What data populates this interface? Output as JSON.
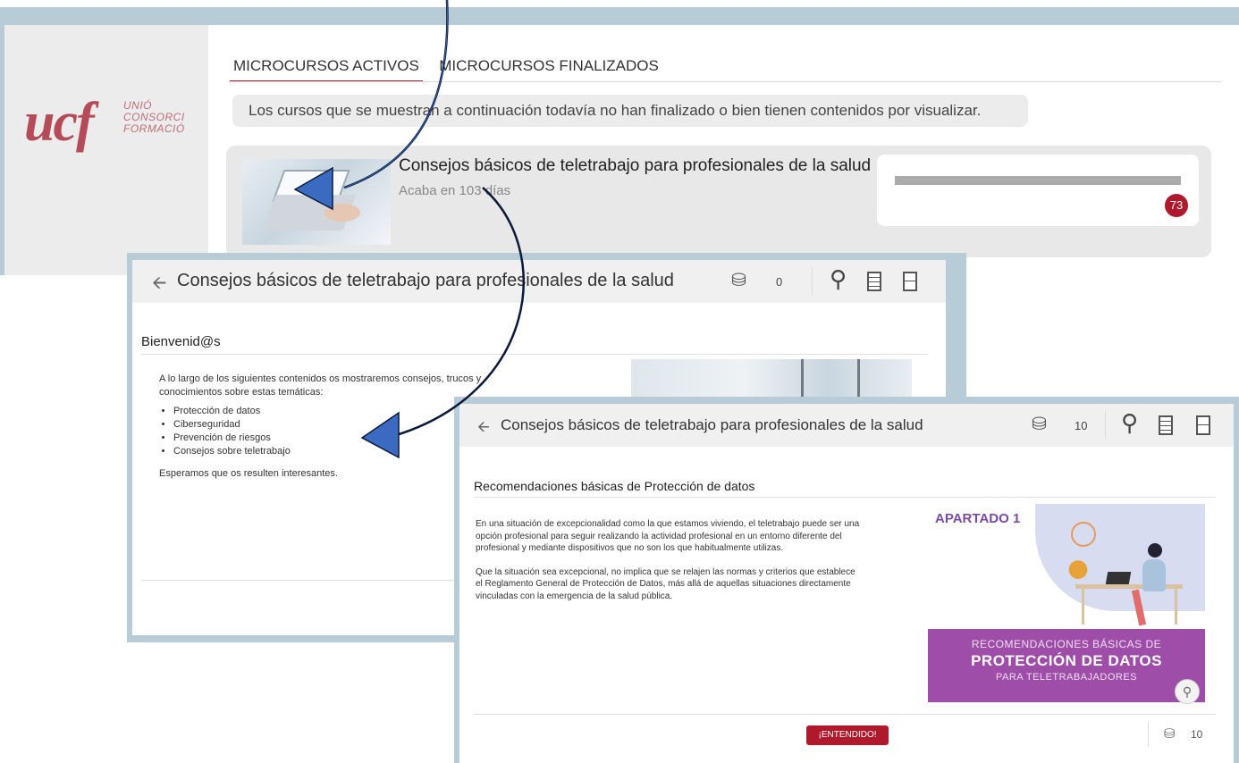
{
  "logo": {
    "mark": "ucf",
    "line1": "UNIÓ",
    "line2": "CONSORCI",
    "line3": "FORMACIÓ"
  },
  "tabs": [
    {
      "label": "MICROCURSOS ACTIVOS",
      "active": true
    },
    {
      "label": "MICROCURSOS FINALIZADOS",
      "active": false
    }
  ],
  "info_banner": "Los cursos que se muestran a continuación todavía no han finalizado o bien tienen contenidos por visualizar.",
  "course": {
    "title": "Consejos básicos de teletrabajo para profesionales de la salud",
    "subtitle": "Acaba en 103 días",
    "badge": "73"
  },
  "module1": {
    "title": "Consejos básicos de teletrabajo para profesionales de la salud",
    "coins": "0",
    "section_title": "Bienvenid@s",
    "intro": "A lo largo de los siguientes contenidos os mostraremos consejos, trucos y conocimientos sobre estas temáticas:",
    "topics": [
      "Protección de datos",
      "Ciberseguridad",
      "Prevención de riesgos",
      "Consejos sobre teletrabajo"
    ],
    "closing": "Esperamos que os resulten interesantes."
  },
  "module2": {
    "title": "Consejos básicos de teletrabajo para profesionales de la salud",
    "coins": "10",
    "section_title": "Recomendaciones básicas de Protección de datos",
    "paragraph1": "En una situación de excepcionalidad como la que estamos viviendo, el teletrabajo puede ser una opción profesional para seguir realizando la actividad profesional en un entorno diferente del profesional y mediante dispositivos que no son los que habitualmente utilizas.",
    "paragraph2": "Que la situación sea excepcional, no implica que se relajen las normas y criterios que establece el Reglamento General de Protección de Datos, más allá de aquellas situaciones directamente vinculadas con la emergencia de la salud pública.",
    "image_label": "APARTADO 1",
    "banner_line1": "RECOMENDACIONES BÁSICAS DE",
    "banner_line2": "PROTECCIÓN DE DATOS",
    "banner_line3": "PARA TELETRABAJADORES",
    "button": "¡ENTENDIDO!",
    "footer_coins": "10"
  },
  "icons": {
    "back": "back-arrow-icon",
    "coins": "coins-icon",
    "search": "search-icon",
    "list": "list-icon",
    "report": "report-icon",
    "zoom": "zoom-icon"
  },
  "colors": {
    "accent": "#b0192b",
    "frame": "#b7ccd6",
    "banner_purple": "#9e4ea8",
    "arrow_blue": "#3a6bc0"
  }
}
